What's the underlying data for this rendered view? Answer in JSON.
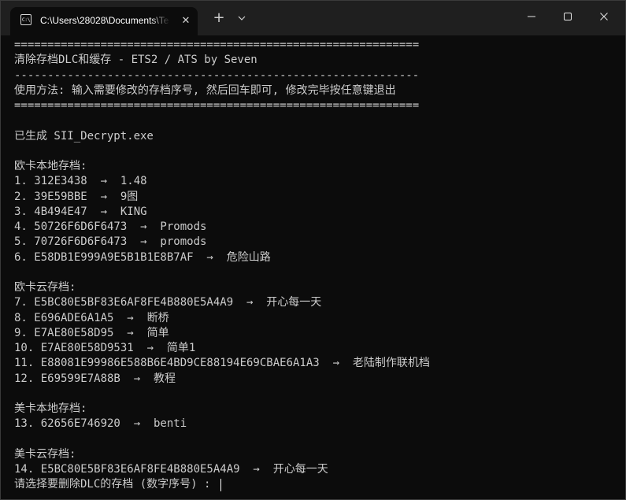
{
  "window": {
    "tab": {
      "icon_name": "terminal-icon",
      "icon_glyph": "C:\\",
      "title": "C:\\Users\\28028\\Documents\\Te",
      "close_glyph": "✕"
    },
    "new_tab_glyph": "+",
    "dropdown_glyph": "⌄",
    "caption": {
      "minimize_icon": "minimize-icon",
      "maximize_icon": "maximize-icon",
      "close_icon": "close-icon"
    }
  },
  "terminal": {
    "lines": [
      "=============================================================",
      "清除存档DLC和缓存 - ETS2 / ATS by Seven",
      "-------------------------------------------------------------",
      "使用方法: 输入需要修改的存档序号, 然后回车即可, 修改完毕按任意键退出",
      "=============================================================",
      "",
      "已生成 SII_Decrypt.exe",
      "",
      "欧卡本地存档:",
      "1. 312E3438  →  1.48",
      "2. 39E59BBE  →  9图",
      "3. 4B494E47  →  KING",
      "4. 50726F6D6F6473  →  Promods",
      "5. 70726F6D6F6473  →  promods",
      "6. E58DB1E999A9E5B1B1E8B7AF  →  危险山路",
      "",
      "欧卡云存档:",
      "7. E5BC80E5BF83E6AF8FE4B880E5A4A9  →  开心每一天",
      "8. E696ADE6A1A5  →  断桥",
      "9. E7AE80E58D95  →  简单",
      "10. E7AE80E58D9531  →  简单1",
      "11. E88081E99986E588B6E4BD9CE88194E69CBAE6A1A3  →  老陆制作联机档",
      "12. E69599E7A88B  →  教程",
      "",
      "美卡本地存档:",
      "13. 62656E746920  →  benti",
      "",
      "美卡云存档:",
      "14. E5BC80E5BF83E6AF8FE4B880E5A4A9  →  开心每一天"
    ],
    "prompt": "请选择要删除DLC的存档 (数字序号) : "
  },
  "colors": {
    "terminal_bg": "#0c0c0c",
    "titlebar_bg": "#1f1f1f",
    "text": "#cccccc"
  }
}
